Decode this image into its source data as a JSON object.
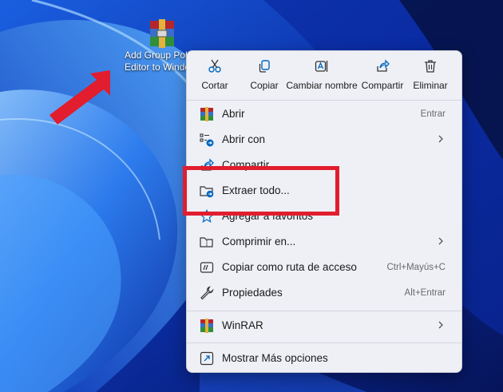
{
  "desktop": {
    "icon_label_line1": "Add Group Poli",
    "icon_label_line2": "Editor to Windo"
  },
  "quick_actions": [
    {
      "label": "Cortar",
      "icon": "scissors-icon"
    },
    {
      "label": "Copiar",
      "icon": "copy-icon"
    },
    {
      "label": "Cambiar nombre",
      "icon": "rename-icon"
    },
    {
      "label": "Compartir",
      "icon": "share-icon"
    },
    {
      "label": "Eliminar",
      "icon": "trash-icon"
    }
  ],
  "menu": {
    "items": [
      {
        "label": "Abrir",
        "shortcut": "Entrar",
        "icon": "winrar-icon"
      },
      {
        "label": "Abrir con",
        "submenu": true,
        "icon": "open-with-icon"
      },
      {
        "label": "Compartir",
        "icon": "share-icon"
      },
      {
        "label": "Extraer todo...",
        "icon": "extract-folder-icon"
      },
      {
        "label": "Agregar a favoritos",
        "icon": "star-icon"
      },
      {
        "label": "Comprimir en...",
        "submenu": true,
        "icon": "zip-folder-icon"
      },
      {
        "label": "Copiar como ruta de acceso",
        "shortcut": "Ctrl+Mayús+C",
        "icon": "path-icon"
      },
      {
        "label": "Propiedades",
        "shortcut": "Alt+Entrar",
        "icon": "wrench-icon"
      },
      {
        "label": "WinRAR",
        "submenu": true,
        "icon": "winrar-icon"
      },
      {
        "label": "Mostrar Más opciones",
        "icon": "more-options-icon"
      }
    ]
  },
  "colors": {
    "highlight": "#e11d2e",
    "accent": "#0067c0",
    "menu_bg": "#eef0f6"
  }
}
